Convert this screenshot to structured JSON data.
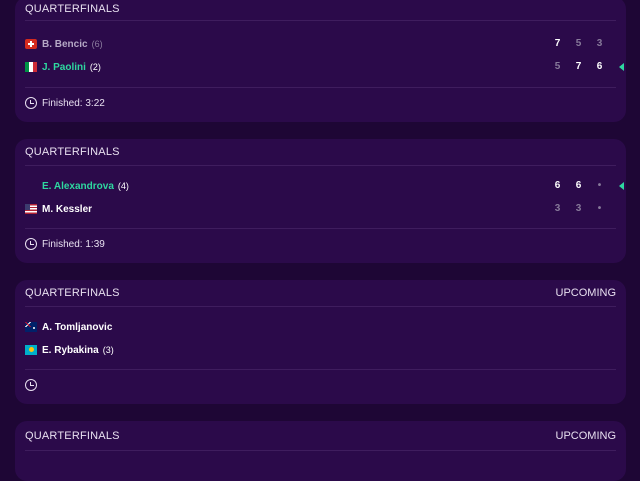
{
  "matches": [
    {
      "round": "QUARTERFINALS",
      "status": "",
      "players": [
        {
          "flag": "switzerland-flag",
          "name": "B. Bencic",
          "seed": "(6)",
          "winner": false,
          "scores": [
            "7",
            "5",
            "3"
          ],
          "serving": false
        },
        {
          "flag": "italy-flag",
          "name": "J. Paolini",
          "seed": "(2)",
          "winner": true,
          "scores": [
            "5",
            "7",
            "6"
          ],
          "serving": true
        }
      ],
      "footer": "Finished: 3:22"
    },
    {
      "round": "QUARTERFINALS",
      "status": "",
      "players": [
        {
          "flag": "",
          "name": "E. Alexandrova",
          "seed": "(4)",
          "winner": true,
          "scores": [
            "6",
            "6",
            "•"
          ],
          "serving": true
        },
        {
          "flag": "usa-flag",
          "name": "M. Kessler",
          "seed": "",
          "winner": false,
          "scores": [
            "3",
            "3",
            "•"
          ],
          "serving": false
        }
      ],
      "footer": "Finished: 1:39"
    },
    {
      "round": "QUARTERFINALS",
      "status": "UPCOMING",
      "players": [
        {
          "flag": "australia-flag",
          "name": "A. Tomljanovic",
          "seed": "",
          "winner": false
        },
        {
          "flag": "kazakhstan-flag",
          "name": "E. Rybakina",
          "seed": "(3)",
          "winner": false
        }
      ],
      "footer": ""
    },
    {
      "round": "QUARTERFINALS",
      "status": "UPCOMING"
    }
  ],
  "colors": {
    "background": "#1e0635",
    "card": "#2b0a4a",
    "winner_accent": "#2ed8a0",
    "divider": "#3f1d5e"
  }
}
